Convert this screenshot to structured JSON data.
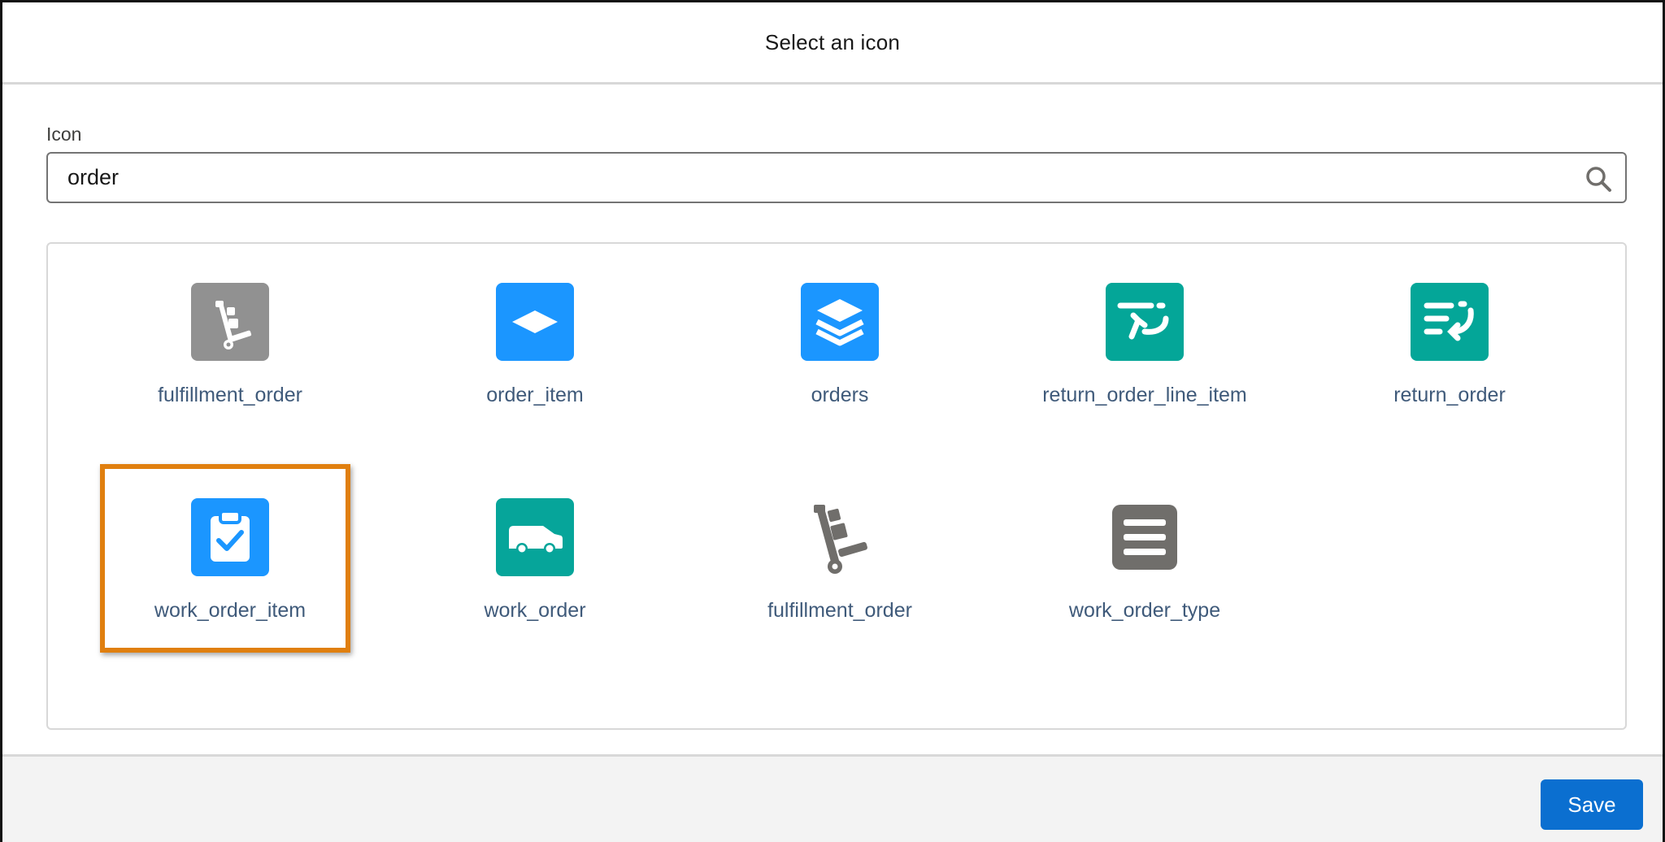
{
  "dialog": {
    "title": "Select an icon"
  },
  "search": {
    "label": "Icon",
    "value": "order"
  },
  "tiles": [
    {
      "label": "fulfillment_order",
      "icon": "hand-truck-icon",
      "color": "#919191"
    },
    {
      "label": "order_item",
      "icon": "diamond-icon",
      "color": "#1b96ff"
    },
    {
      "label": "orders",
      "icon": "stacked-layers-icon",
      "color": "#1b96ff"
    },
    {
      "label": "return_order_line_item",
      "icon": "return-line-icon",
      "color": "#04a698"
    },
    {
      "label": "return_order",
      "icon": "return-list-icon",
      "color": "#04a698"
    },
    {
      "label": "work_order_item",
      "icon": "clipboard-check-icon",
      "color": "#1b96ff",
      "highlighted": true
    },
    {
      "label": "work_order",
      "icon": "van-icon",
      "color": "#06a59a"
    },
    {
      "label": "fulfillment_order",
      "icon": "hand-truck-utility-icon",
      "color": "#706e6b"
    },
    {
      "label": "work_order_type",
      "icon": "list-lines-icon",
      "color": "#706e6b"
    }
  ],
  "footer": {
    "save_label": "Save"
  },
  "colors": {
    "highlight": "#e07f0f",
    "brand": "#0b6fd0",
    "label": "#3f5a7a"
  }
}
